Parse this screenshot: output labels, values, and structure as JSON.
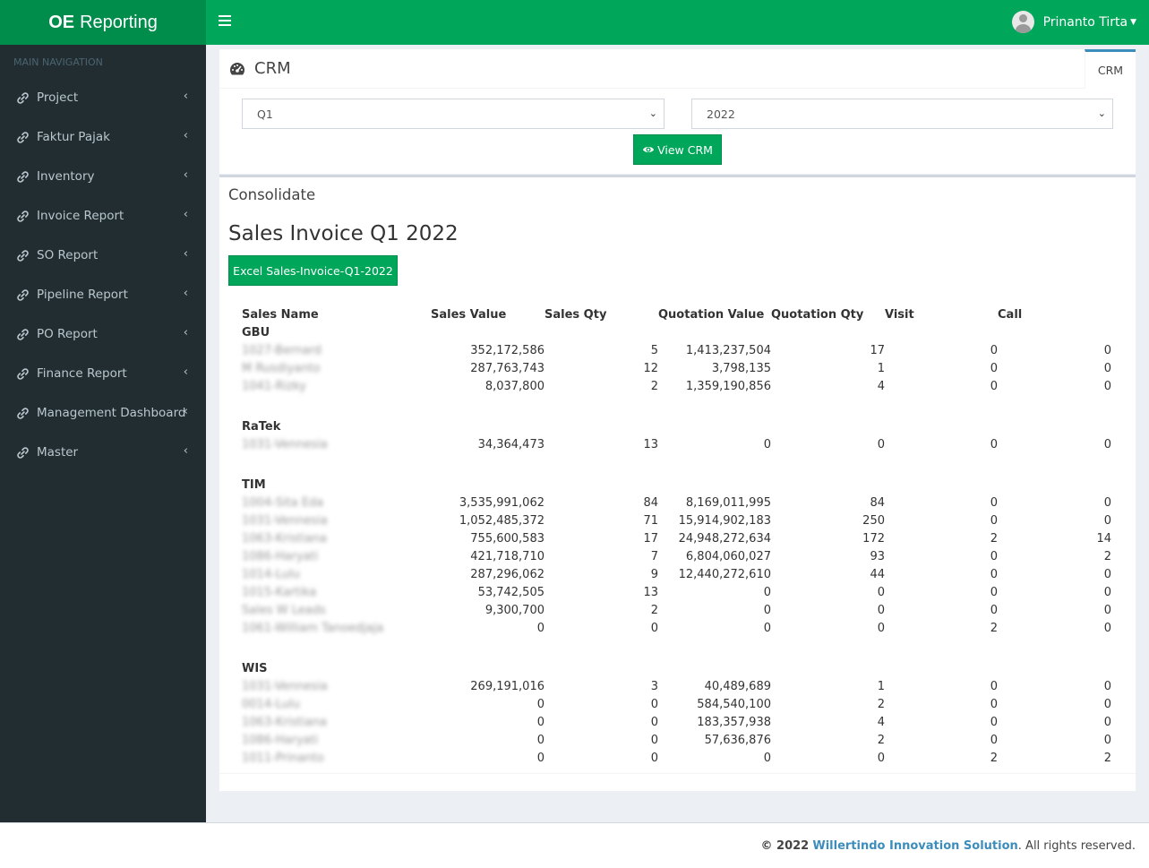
{
  "app": {
    "logo_bold": "OE",
    "logo_rest": "Reporting"
  },
  "header": {
    "user_name": "Prinanto Tirta"
  },
  "sidebar": {
    "header": "MAIN NAVIGATION",
    "items": [
      {
        "label": "Project"
      },
      {
        "label": "Faktur Pajak"
      },
      {
        "label": "Inventory"
      },
      {
        "label": "Invoice Report"
      },
      {
        "label": "SO Report"
      },
      {
        "label": "Pipeline Report"
      },
      {
        "label": "PO Report"
      },
      {
        "label": "Finance Report"
      },
      {
        "label": "Management Dashboard"
      },
      {
        "label": "Master"
      }
    ]
  },
  "filter": {
    "title": "CRM",
    "tab_label": "CRM",
    "quarter_value": "Q1",
    "year_value": "2022",
    "view_button": "View CRM"
  },
  "report": {
    "section_title": "Consolidate",
    "title": "Sales Invoice Q1 2022",
    "excel_button": "Excel Sales-Invoice-Q1-2022",
    "columns": [
      "Sales Name",
      "Sales Value",
      "Sales Qty",
      "Quotation Value",
      "Quotation Qty",
      "Visit",
      "Call"
    ],
    "groups": [
      {
        "name": "GBU",
        "rows": [
          {
            "name": "1027-Bernard",
            "sales_value": "352,172,586",
            "sales_qty": "5",
            "quotation_value": "1,413,237,504",
            "quotation_qty": "17",
            "visit": "0",
            "call": "0"
          },
          {
            "name": "M Rusdiyanto",
            "sales_value": "287,763,743",
            "sales_qty": "12",
            "quotation_value": "3,798,135",
            "quotation_qty": "1",
            "visit": "0",
            "call": "0"
          },
          {
            "name": "1041-Rizky",
            "sales_value": "8,037,800",
            "sales_qty": "2",
            "quotation_value": "1,359,190,856",
            "quotation_qty": "4",
            "visit": "0",
            "call": "0"
          }
        ]
      },
      {
        "name": "RaTek",
        "rows": [
          {
            "name": "1031-Vennesia",
            "sales_value": "34,364,473",
            "sales_qty": "13",
            "quotation_value": "0",
            "quotation_qty": "0",
            "visit": "0",
            "call": "0"
          }
        ]
      },
      {
        "name": "TIM",
        "rows": [
          {
            "name": "1004-Sita Eda",
            "sales_value": "3,535,991,062",
            "sales_qty": "84",
            "quotation_value": "8,169,011,995",
            "quotation_qty": "84",
            "visit": "0",
            "call": "0"
          },
          {
            "name": "1031-Vennesia",
            "sales_value": "1,052,485,372",
            "sales_qty": "71",
            "quotation_value": "15,914,902,183",
            "quotation_qty": "250",
            "visit": "0",
            "call": "0"
          },
          {
            "name": "1063-Kristiana",
            "sales_value": "755,600,583",
            "sales_qty": "17",
            "quotation_value": "24,948,272,634",
            "quotation_qty": "172",
            "visit": "2",
            "call": "14"
          },
          {
            "name": "1086-Haryati",
            "sales_value": "421,718,710",
            "sales_qty": "7",
            "quotation_value": "6,804,060,027",
            "quotation_qty": "93",
            "visit": "0",
            "call": "2"
          },
          {
            "name": "1014-Lulu",
            "sales_value": "287,296,062",
            "sales_qty": "9",
            "quotation_value": "12,440,272,610",
            "quotation_qty": "44",
            "visit": "0",
            "call": "0"
          },
          {
            "name": "1015-Kartika",
            "sales_value": "53,742,505",
            "sales_qty": "13",
            "quotation_value": "0",
            "quotation_qty": "0",
            "visit": "0",
            "call": "0"
          },
          {
            "name": "Sales W Leads",
            "sales_value": "9,300,700",
            "sales_qty": "2",
            "quotation_value": "0",
            "quotation_qty": "0",
            "visit": "0",
            "call": "0"
          },
          {
            "name": "1061-William Tanoedjaja",
            "sales_value": "0",
            "sales_qty": "0",
            "quotation_value": "0",
            "quotation_qty": "0",
            "visit": "2",
            "call": "0"
          }
        ]
      },
      {
        "name": "WIS",
        "rows": [
          {
            "name": "1031-Vennesia",
            "sales_value": "269,191,016",
            "sales_qty": "3",
            "quotation_value": "40,489,689",
            "quotation_qty": "1",
            "visit": "0",
            "call": "0"
          },
          {
            "name": "0014-Lulu",
            "sales_value": "0",
            "sales_qty": "0",
            "quotation_value": "584,540,100",
            "quotation_qty": "2",
            "visit": "0",
            "call": "0"
          },
          {
            "name": "1063-Kristiana",
            "sales_value": "0",
            "sales_qty": "0",
            "quotation_value": "183,357,938",
            "quotation_qty": "4",
            "visit": "0",
            "call": "0"
          },
          {
            "name": "1086-Haryati",
            "sales_value": "0",
            "sales_qty": "0",
            "quotation_value": "57,636,876",
            "quotation_qty": "2",
            "visit": "0",
            "call": "0"
          },
          {
            "name": "1011-Prinanto",
            "sales_value": "0",
            "sales_qty": "0",
            "quotation_value": "0",
            "quotation_qty": "0",
            "visit": "2",
            "call": "2"
          }
        ]
      }
    ]
  },
  "footer": {
    "copyright": "© 2022",
    "company": "Willertindo Innovation Solution",
    "rights": ". All rights reserved."
  },
  "colors": {
    "primary": "#00a65a",
    "primary_dark": "#008d4c",
    "sidebar_bg": "#222d32",
    "link": "#3c8dbc"
  },
  "icons": {
    "nav": "link-icon",
    "nav_arrow": "chevron-left-icon",
    "crm": "dashboard-icon",
    "view": "eye-icon",
    "menu": "hamburger-icon"
  }
}
